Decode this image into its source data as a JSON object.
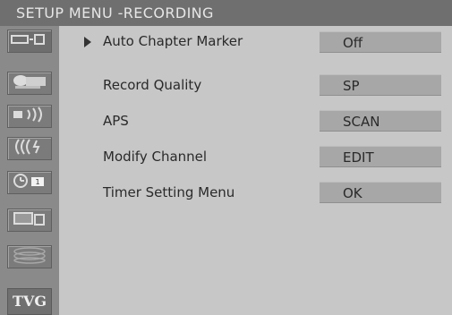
{
  "header": {
    "title": "SETUP MENU -RECORDING"
  },
  "sidebar": {
    "icons": [
      "disc-recording-icon",
      "video-camera-icon",
      "speaker-audio-icon",
      "antenna-channel-icon",
      "clock-timer-icon",
      "tv-display-icon",
      "disc-stack-icon"
    ],
    "tvg_label": "TVG"
  },
  "menu": {
    "items": [
      {
        "label": "Auto Chapter Marker",
        "value": "Off"
      },
      {
        "label": "Record Quality",
        "value": "SP"
      },
      {
        "label": "APS",
        "value": "SCAN"
      },
      {
        "label": "Modify Channel",
        "value": "EDIT"
      },
      {
        "label": "Timer Setting Menu",
        "value": "OK"
      }
    ]
  },
  "colors": {
    "title_bar": "#6f6f6f",
    "panel": "#c7c7c7",
    "sidebar": "#8a8a8a",
    "value_box": "#a7a7a7"
  }
}
